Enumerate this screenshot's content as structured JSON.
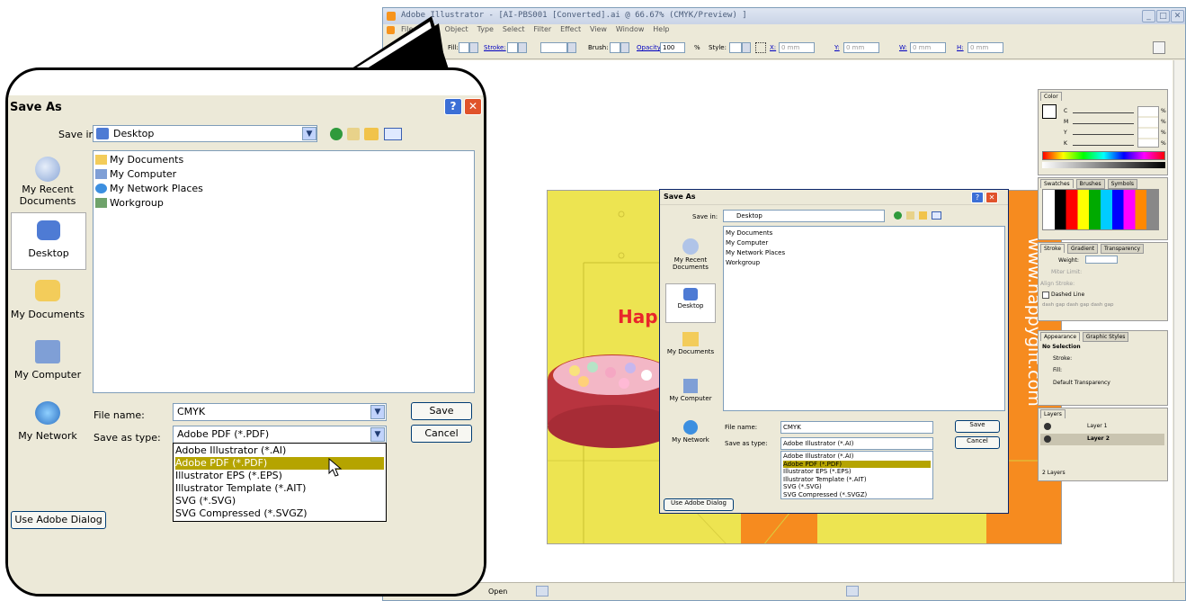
{
  "illustrator": {
    "title": "Adobe Illustrator - [AI-PBS001 [Converted].ai @ 66.67% (CMYK/Preview) ]",
    "menu": [
      "File",
      "Edit",
      "Object",
      "Type",
      "Select",
      "Filter",
      "Effect",
      "View",
      "Window",
      "Help"
    ],
    "control_bar": {
      "fill_label": "Fill:",
      "stroke_label": "Stroke:",
      "brush_label": "Brush:",
      "opacity_label": "Opacity:",
      "opacity_value": "100",
      "opacity_unit": "%",
      "style_label": "Style:",
      "x_label": "X:",
      "y_label": "Y:",
      "w_label": "W:",
      "h_label": "H:",
      "x_value": "0 mm",
      "y_value": "0 mm",
      "w_value": "0 mm",
      "h_value": "0 mm"
    },
    "status": "Open",
    "artboard": {
      "happy_text": "Happ",
      "url_text": "www.happygift.com"
    }
  },
  "save_dialog": {
    "title": "Save As",
    "save_in_label": "Save in:",
    "save_in_value": "Desktop",
    "places": [
      "My Recent Documents",
      "Desktop",
      "My Documents",
      "My Computer",
      "My Network"
    ],
    "files": [
      "My Documents",
      "My Computer",
      "My Network Places",
      "Workgroup"
    ],
    "file_name_label": "File name:",
    "file_name_value": "CMYK",
    "save_as_type_label": "Save as type:",
    "save_as_type_value": "Adobe PDF (*.PDF)",
    "type_options": [
      "Adobe Illustrator (*.AI)",
      "Adobe PDF (*.PDF)",
      "Illustrator EPS (*.EPS)",
      "Illustrator Template (*.AIT)",
      "SVG (*.SVG)",
      "SVG Compressed (*.SVGZ)"
    ],
    "save_button": "Save",
    "cancel_button": "Cancel",
    "adobe_dialog_button": "Use Adobe Dialog"
  },
  "small_dialog": {
    "save_as_type_value": "Adobe Illustrator (*.AI)"
  },
  "panels": {
    "color": {
      "tab": "Color",
      "channels": [
        "C",
        "M",
        "Y",
        "K"
      ],
      "unit": "%"
    },
    "swatches": {
      "tabs": [
        "Swatches",
        "Brushes",
        "Symbols"
      ]
    },
    "stroke": {
      "tabs": [
        "Stroke",
        "Gradient",
        "Transparency"
      ],
      "weight_label": "Weight:",
      "miter_label": "Miter Limit:",
      "align_label": "Align Stroke:",
      "dashed_label": "Dashed Line",
      "dash_labels": [
        "dash",
        "gap",
        "dash",
        "gap",
        "dash",
        "gap"
      ]
    },
    "appearance": {
      "tabs": [
        "Appearance",
        "Graphic Styles"
      ],
      "rows": [
        "No Selection",
        "Stroke:",
        "Fill:",
        "Default Transparency"
      ]
    },
    "layers": {
      "tab": "Layers",
      "items": [
        "Layer 1",
        "Layer 2"
      ],
      "count": "2 Layers"
    }
  },
  "colors": {
    "artboard_yellow": "#ede451",
    "orange": "#f68b1f",
    "selection_olive": "#b5a400",
    "xp_face": "#ece9d8"
  }
}
